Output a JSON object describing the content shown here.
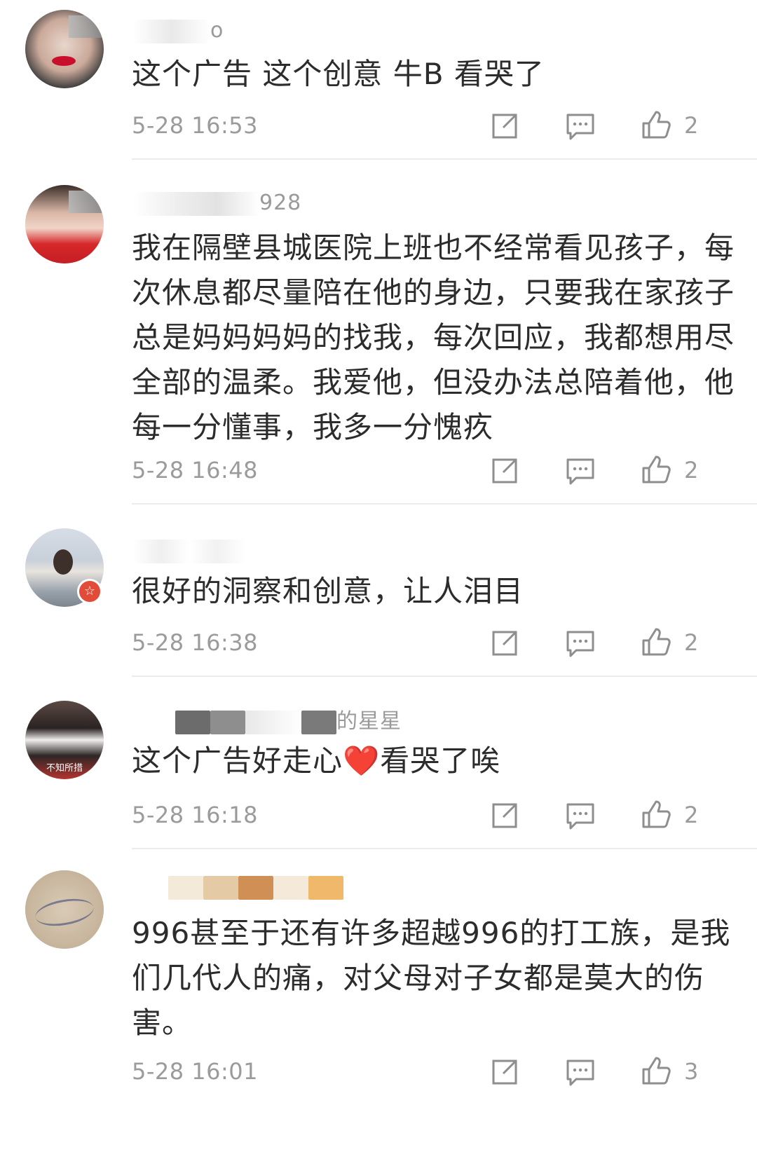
{
  "comments": [
    {
      "username": "o",
      "text": "这个广告 这个创意  牛B  看哭了",
      "time": "5-28 16:53",
      "likes": "2"
    },
    {
      "username": "928",
      "text": "我在隔壁县城医院上班也不经常看见孩子，每次休息都尽量陪在他的身边，只要我在家孩子总是妈妈妈妈的找我，每次回应，我都想用尽全部的温柔。我爱他，但没办法总陪着他，他每一分懂事，我多一分愧疚",
      "time": "5-28 16:48",
      "likes": "2"
    },
    {
      "username": "",
      "text": "很好的洞察和创意，让人泪目",
      "time": "5-28 16:38",
      "likes": "2",
      "avatar_badge": "☆"
    },
    {
      "username": "的星星",
      "text": "这个广告好走心❤️看哭了唉",
      "time": "5-28 16:18",
      "likes": "2",
      "avatar_caption": "不知所措"
    },
    {
      "username": "",
      "text": "996甚至于还有许多超越996的打工族，是我们几代人的痛，对父母对子女都是莫大的伤害。",
      "time": "5-28 16:01",
      "likes": "3"
    }
  ],
  "icons": {
    "share": "share-icon",
    "reply": "comment-icon",
    "like": "thumbs-up-icon"
  }
}
